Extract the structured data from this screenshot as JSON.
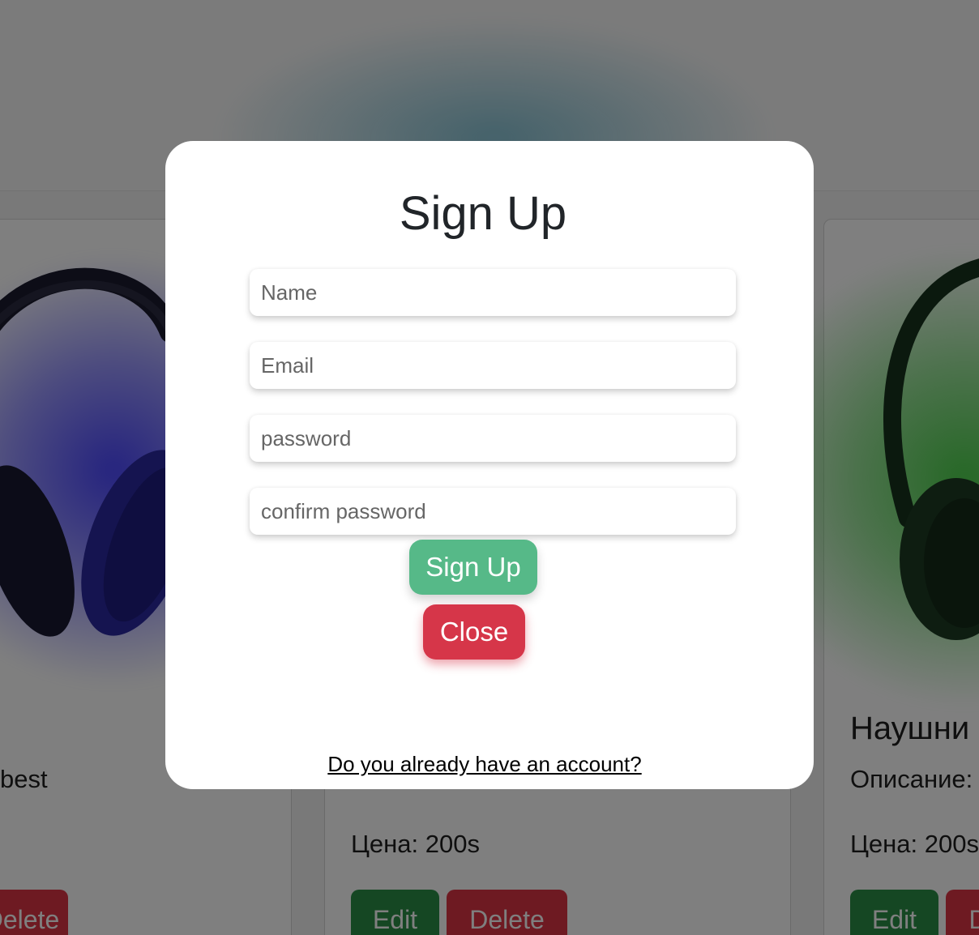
{
  "background": {
    "cards": [
      {
        "description_fragment": "best",
        "delete_label": "Delete"
      },
      {
        "price": "Цена: 200s",
        "edit_label": "Edit",
        "delete_label": "Delete"
      },
      {
        "title": "Наушни",
        "description": "Описание:",
        "price": "Цена: 200s",
        "edit_label": "Edit",
        "delete_label": "D"
      }
    ]
  },
  "modal": {
    "title": "Sign Up",
    "fields": {
      "name": {
        "placeholder": "Name",
        "value": ""
      },
      "email": {
        "placeholder": "Email",
        "value": ""
      },
      "password": {
        "placeholder": "password",
        "value": ""
      },
      "confirm_password": {
        "placeholder": "confirm password",
        "value": ""
      }
    },
    "signup_button_label": "Sign Up",
    "close_button_label": "Close",
    "account_link": "Do you already have an account?"
  },
  "colors": {
    "signup_button": "#56b988",
    "close_button": "#d63649",
    "edit_button": "#2a8f47",
    "delete_button": "#dc3545",
    "overlay": "rgba(0,0,0,0.5)"
  }
}
